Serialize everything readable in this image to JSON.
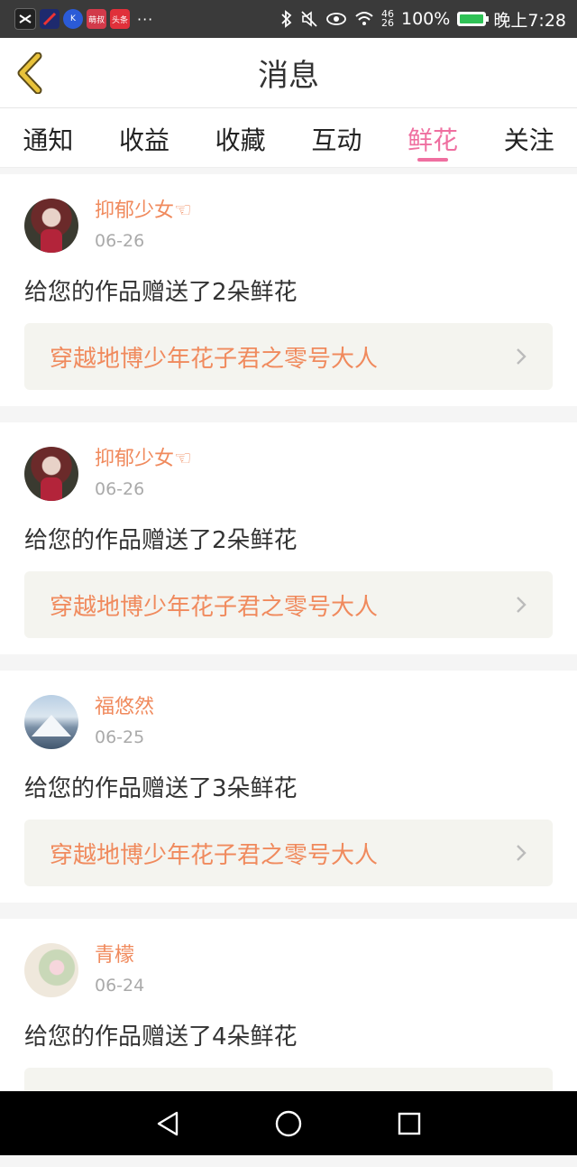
{
  "status_bar": {
    "app_icons": [
      {
        "name": "capcut-app-icon",
        "text": ""
      },
      {
        "name": "photo-app-icon",
        "text": ""
      },
      {
        "name": "kuaishou-app-icon",
        "text": "K"
      },
      {
        "name": "mengbao-app-icon",
        "text": "萌叔"
      },
      {
        "name": "toutiao-app-icon",
        "text": "头条"
      }
    ],
    "more": "···",
    "signal": [
      "46",
      "26"
    ],
    "battery": "100%",
    "time": "晚上7:28"
  },
  "header": {
    "title": "消息"
  },
  "tabs": [
    {
      "label": "通知",
      "active": false
    },
    {
      "label": "收益",
      "active": false
    },
    {
      "label": "收藏",
      "active": false
    },
    {
      "label": "互动",
      "active": false
    },
    {
      "label": "鲜花",
      "active": true
    },
    {
      "label": "关注",
      "active": false
    }
  ],
  "messages": [
    {
      "username": "抑郁少女☜",
      "date": "06-26",
      "text": "给您的作品赠送了2朵鲜花",
      "work": "穿越地博少年花子君之零号大人",
      "avatar": "girl"
    },
    {
      "username": "抑郁少女☜",
      "date": "06-26",
      "text": "给您的作品赠送了2朵鲜花",
      "work": "穿越地博少年花子君之零号大人",
      "avatar": "girl"
    },
    {
      "username": "福悠然",
      "date": "06-25",
      "text": "给您的作品赠送了3朵鲜花",
      "work": "穿越地博少年花子君之零号大人",
      "avatar": "mountain"
    },
    {
      "username": "青檬",
      "date": "06-24",
      "text": "给您的作品赠送了4朵鲜花",
      "work": "",
      "avatar": "flower"
    }
  ],
  "colors": {
    "accent_pink": "#ef6fa0",
    "accent_orange": "#f08a5d",
    "back_arrow": "#e8c23a"
  },
  "icons": {
    "back": "chevron-left-icon",
    "link": "chevron-right-icon",
    "nav": [
      "back-triangle-icon",
      "home-circle-icon",
      "recents-square-icon"
    ]
  }
}
